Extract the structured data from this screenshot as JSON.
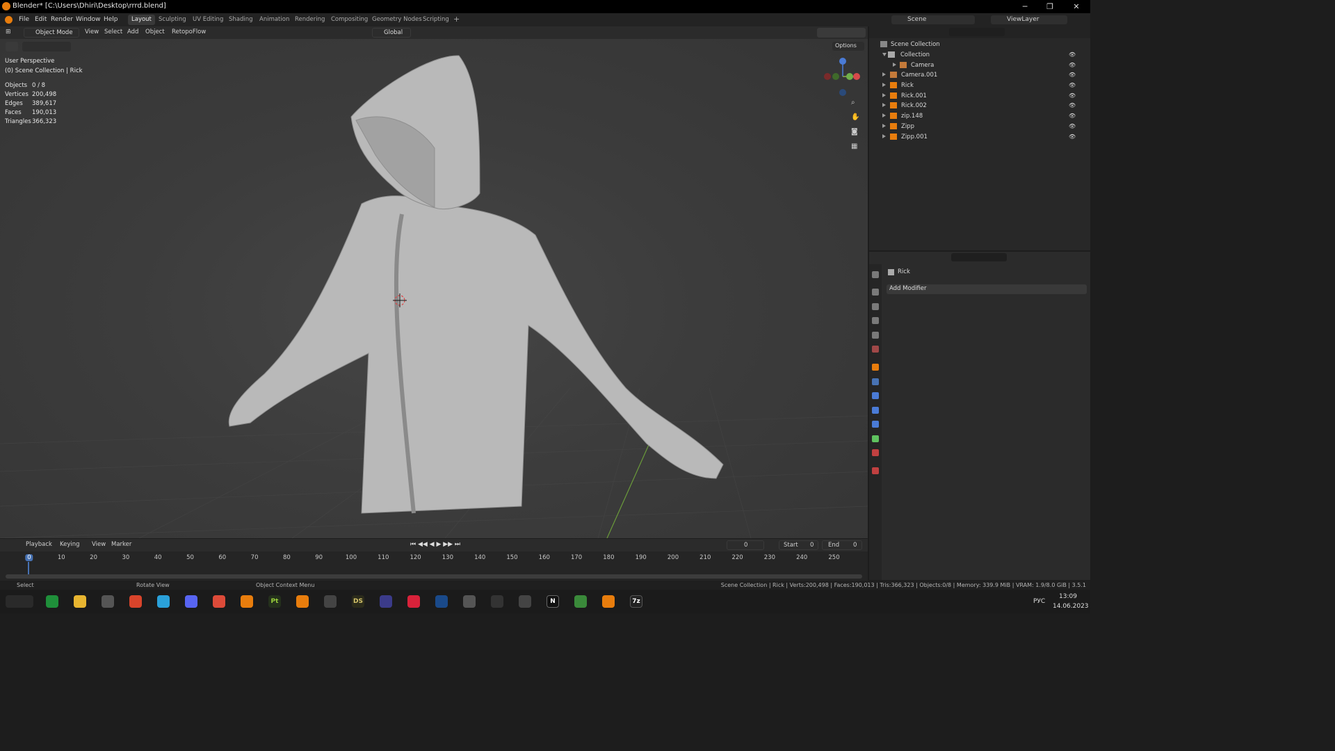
{
  "window": {
    "title": "Blender* [C:\\Users\\Dhiri\\Desktop\\rrrd.blend]"
  },
  "menu": [
    "File",
    "Edit",
    "Render",
    "Window",
    "Help"
  ],
  "workspaces": [
    "Layout",
    "Sculpting",
    "UV Editing",
    "Shading",
    "Animation",
    "Rendering",
    "Compositing",
    "Geometry Nodes",
    "Scripting"
  ],
  "viewport_header": {
    "mode": "Object Mode",
    "items": [
      "View",
      "Select",
      "Add",
      "Object"
    ],
    "addon": "RetopoFlow",
    "transform": "Global",
    "options": "Options"
  },
  "overlay": {
    "perspective": "User Perspective",
    "collection": "(0) Scene Collection | Rick",
    "stats": [
      {
        "label": "Objects",
        "value": "0 / 8"
      },
      {
        "label": "Vertices",
        "value": "200,498"
      },
      {
        "label": "Edges",
        "value": "389,617"
      },
      {
        "label": "Faces",
        "value": "190,013"
      },
      {
        "label": "Triangles",
        "value": "366,323"
      }
    ]
  },
  "scene": {
    "scene_name": "Scene",
    "view_layer": "ViewLayer"
  },
  "outliner": {
    "root": "Scene Collection",
    "items": [
      {
        "name": "Collection",
        "type": "collection"
      },
      {
        "name": "Camera",
        "type": "camera"
      },
      {
        "name": "Camera.001",
        "type": "camera"
      },
      {
        "name": "Rick",
        "type": "mesh"
      },
      {
        "name": "Rick.001",
        "type": "mesh"
      },
      {
        "name": "Rick.002",
        "type": "mesh"
      },
      {
        "name": "zip.148",
        "type": "mesh"
      },
      {
        "name": "Zipp",
        "type": "mesh"
      },
      {
        "name": "Zipp.001",
        "type": "mesh"
      }
    ]
  },
  "properties": {
    "object_name": "Rick",
    "add_modifier": "Add Modifier"
  },
  "timeline": {
    "menus": [
      "Playback",
      "Keying",
      "View",
      "Marker"
    ],
    "current_frame": "0",
    "start_label": "Start",
    "start": "0",
    "end_label": "End",
    "end": "0",
    "ticks": [
      "0",
      "10",
      "20",
      "30",
      "40",
      "50",
      "60",
      "70",
      "80",
      "90",
      "100",
      "110",
      "120",
      "130",
      "140",
      "150",
      "160",
      "170",
      "180",
      "190",
      "200",
      "210",
      "220",
      "230",
      "240",
      "250"
    ]
  },
  "statusbar": {
    "select": "Select",
    "rotate": "Rotate View",
    "context": "Object Context Menu",
    "info": "Scene Collection | Rick | Verts:200,498 | Faces:190,013 | Tris:366,323 | Objects:0/8 | Memory: 339.9 MiB | VRAM: 1.9/8.0 GiB | 3.5.1"
  },
  "taskbar": {
    "lang": "РУС",
    "time": "13:09",
    "date": "14.06.2023"
  },
  "colors": {
    "accent": "#4772b3",
    "orange": "#e87d0d",
    "mesh_green": "#5fc25f"
  }
}
